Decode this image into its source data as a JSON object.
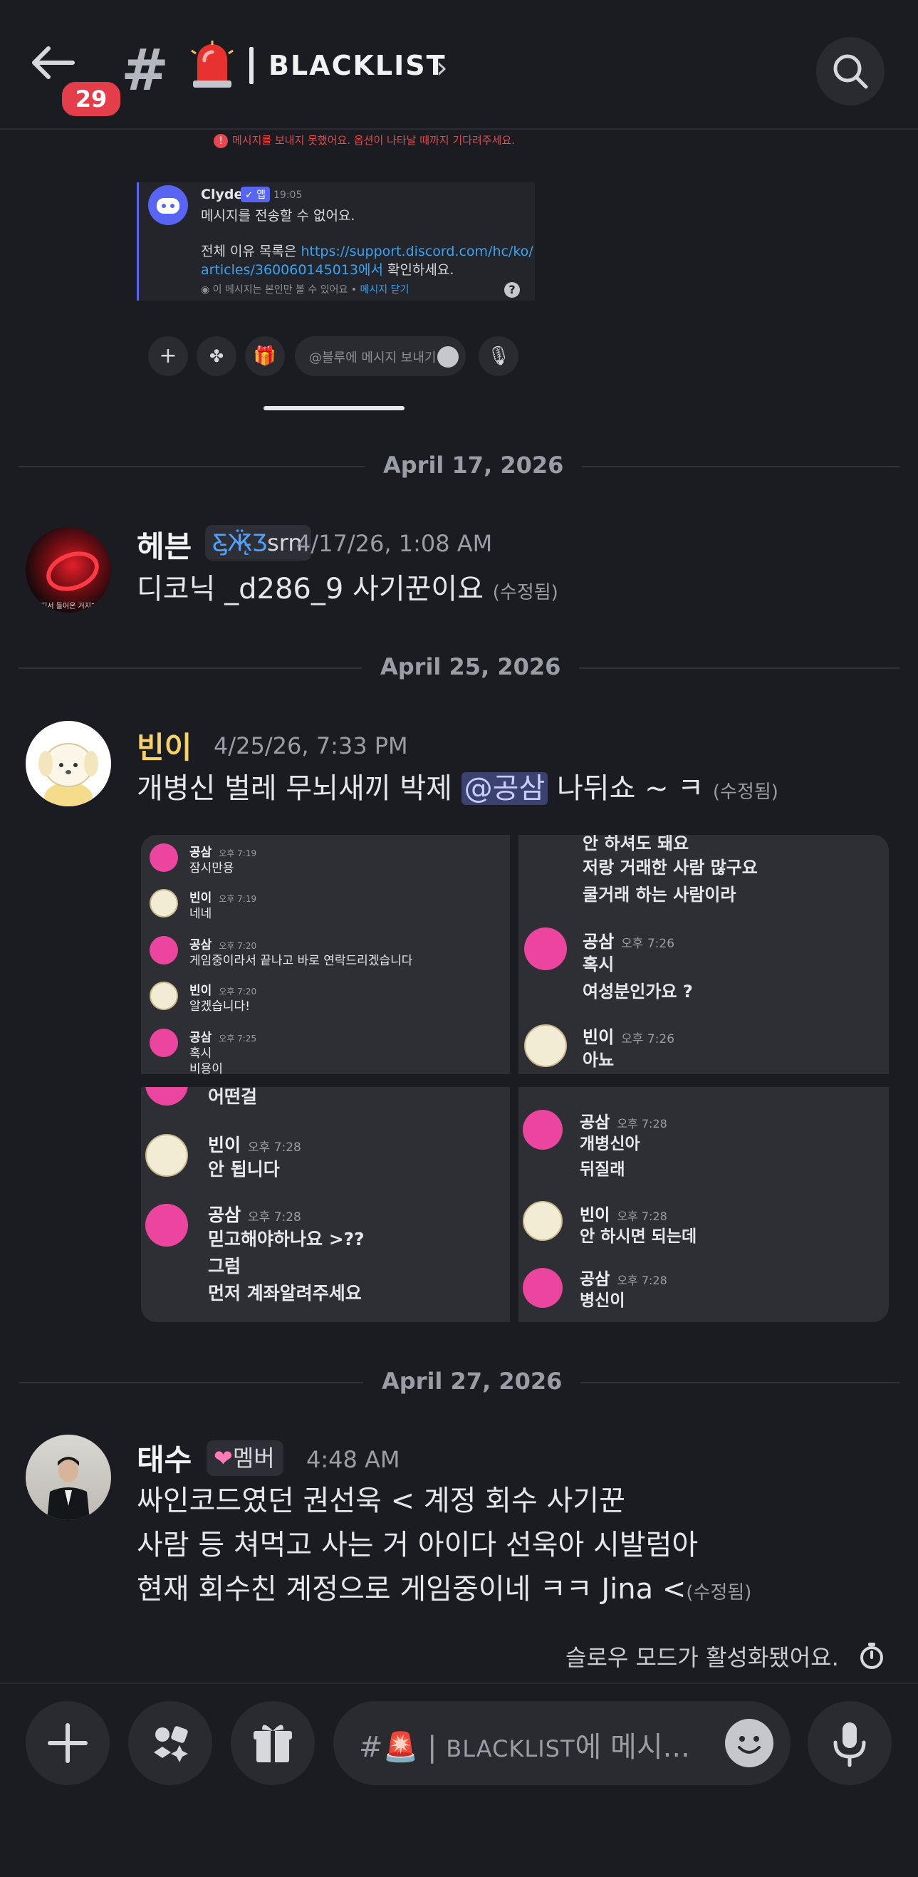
{
  "header": {
    "unread_count": "29",
    "channel_name": "BLACKLIST"
  },
  "embedded_screenshot": {
    "error_text": "메시지를 보내지 못했어요. 옵션이 나타날 때까지 기다려주세요.",
    "clyde": {
      "name": "Clyde",
      "app_badge": "✓ 앱",
      "time": "19:05",
      "line1": "메시지를 전송할 수 없어요.",
      "line2_prefix": "전체 이유 목록은 ",
      "link1": "https://support.discord.com/hc/ko/",
      "link2": "articles/360060145013에서",
      "line3_suffix": " 확인하세요.",
      "footer": "이 메시지는 본인만 볼 수 있어요 •",
      "footer_link": "메시지 닫기"
    },
    "composer_placeholder": "@블루에 메시지 보내기"
  },
  "dates": {
    "d1": "April 17, 2026",
    "d2": "April 25, 2026",
    "d3": "April 27, 2026"
  },
  "messages": [
    {
      "username": "헤븐",
      "username_color": "#f2f3f5",
      "role": "srn",
      "timestamp": "4/17/26, 1:08 AM",
      "text": "디코닉 _d286_9  사기꾼이요",
      "edited": "(수정됨)",
      "avatar_caption": "아지서 들어온 거지?"
    },
    {
      "username": "빈이",
      "username_color": "#f5d36a",
      "timestamp": "4/25/26, 7:33 PM",
      "text_before": "개병신 벌레 무뇌새끼 박제 ",
      "mention": "@공삼",
      "text_after": " 나뒤쇼 ~ ㅋ",
      "edited": "(수정됨)"
    },
    {
      "username": "태수",
      "username_color": "#f2f3f5",
      "role": "멤버",
      "timestamp": "4:48 AM",
      "line1": "싸인코드였던 권선욱 < 계정 회수 사기꾼",
      "line2": "사람 등 쳐먹고 사는 거 아이다 선욱아 시발럼아",
      "line3": "현재 회수친 계정으로 게임중이네 ㅋㅋ Jina <",
      "edited": "(수정됨)"
    }
  ],
  "attachments": {
    "shot1": [
      {
        "name": "공삼",
        "time": "오후 7:19",
        "text": "잠시만용",
        "avatar": "discord"
      },
      {
        "name": "빈이",
        "time": "오후 7:19",
        "text": "네네",
        "avatar": "dog"
      },
      {
        "name": "공삼",
        "time": "오후 7:20",
        "text": "게임중이라서 끝나고 바로 연락드리겠습니다",
        "avatar": "discord"
      },
      {
        "name": "빈이",
        "time": "오후 7:20",
        "text": "알겠습니다!",
        "avatar": "dog"
      },
      {
        "name": "공삼",
        "time": "오후 7:25",
        "text": "혹시",
        "text2": "비용이",
        "avatar": "discord"
      }
    ],
    "shot2": {
      "top_cut": "안 하셔도 돼요",
      "line_a": "저랑 거래한 사람 많구요",
      "line_b": "쿨거래 하는 사람이라",
      "msgs": [
        {
          "name": "공삼",
          "time": "오후 7:26",
          "text": "혹시",
          "text2": "여성분인가요 ?",
          "avatar": "discord"
        },
        {
          "name": "빈이",
          "time": "오후 7:26",
          "text": "아뇨",
          "avatar": "dog"
        }
      ]
    },
    "shot3": {
      "top_cut": "어떤걸",
      "msgs": [
        {
          "name": "빈이",
          "time": "오후 7:28",
          "text": "안 됩니다",
          "avatar": "dog"
        },
        {
          "name": "공삼",
          "time": "오후 7:28",
          "text": "믿고해야하나요 >??",
          "text2": "그럼",
          "text3": "먼저 계좌알려주세요",
          "avatar": "discord"
        }
      ]
    },
    "shot4": {
      "msgs": [
        {
          "name": "공삼",
          "time": "오후 7:28",
          "text": "개병신아",
          "text2": "뒤질래",
          "avatar": "discord"
        },
        {
          "name": "빈이",
          "time": "오후 7:28",
          "text": "안 하시면 되는데",
          "avatar": "dog"
        },
        {
          "name": "공삼",
          "time": "오후 7:28",
          "text": "병신이",
          "avatar": "discord"
        }
      ]
    }
  },
  "slowmode_text": "슬로우 모드가 활성화됐어요.",
  "composer": {
    "placeholder_hash": "#",
    "placeholder_channel": "BLACKLIST",
    "placeholder_suffix": "에 메시..."
  }
}
